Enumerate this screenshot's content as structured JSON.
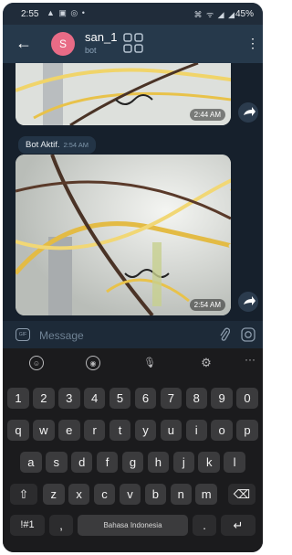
{
  "status_bar": {
    "time": "2:55",
    "left_icons": "▲ ▣ ◎ •",
    "right_icons": "⌘ ᯤ ◢ ◢",
    "battery": "45%"
  },
  "header": {
    "avatar_letter": "S",
    "name": "san_1",
    "subtitle": "bot",
    "back_glyph": "←",
    "more_glyph": "⋮"
  },
  "messages": [
    {
      "type": "photo",
      "time": "2:44 AM"
    },
    {
      "type": "text",
      "text": "Bot Aktif.",
      "time": "2:54 AM"
    },
    {
      "type": "photo",
      "time": "2:54 AM"
    }
  ],
  "input": {
    "placeholder": "Message",
    "gif_label": "GIF"
  },
  "keyboard": {
    "rows": [
      [
        "1",
        "2",
        "3",
        "4",
        "5",
        "6",
        "7",
        "8",
        "9",
        "0"
      ],
      [
        "q",
        "w",
        "e",
        "r",
        "t",
        "y",
        "u",
        "i",
        "o",
        "p"
      ],
      [
        "a",
        "s",
        "d",
        "f",
        "g",
        "h",
        "j",
        "k",
        "l"
      ],
      [
        "⇧",
        "z",
        "x",
        "c",
        "v",
        "b",
        "n",
        "m",
        "⌫"
      ],
      [
        "!#1",
        ",",
        "Bahasa Indonesia",
        ".",
        "↵"
      ]
    ]
  },
  "icons": [
    "back-arrow-icon",
    "grid-icon",
    "more-vert-icon",
    "share-icon",
    "gif-icon",
    "attach-icon",
    "camera-icon",
    "emoji-icon",
    "sticker-icon",
    "mic-icon",
    "settings-icon"
  ],
  "colors": {
    "header": "#26394b",
    "chat_bg": "#16202c",
    "avatar": "#e86b86",
    "keyboard": "#1b1b1d",
    "key": "#3b3b3d"
  }
}
